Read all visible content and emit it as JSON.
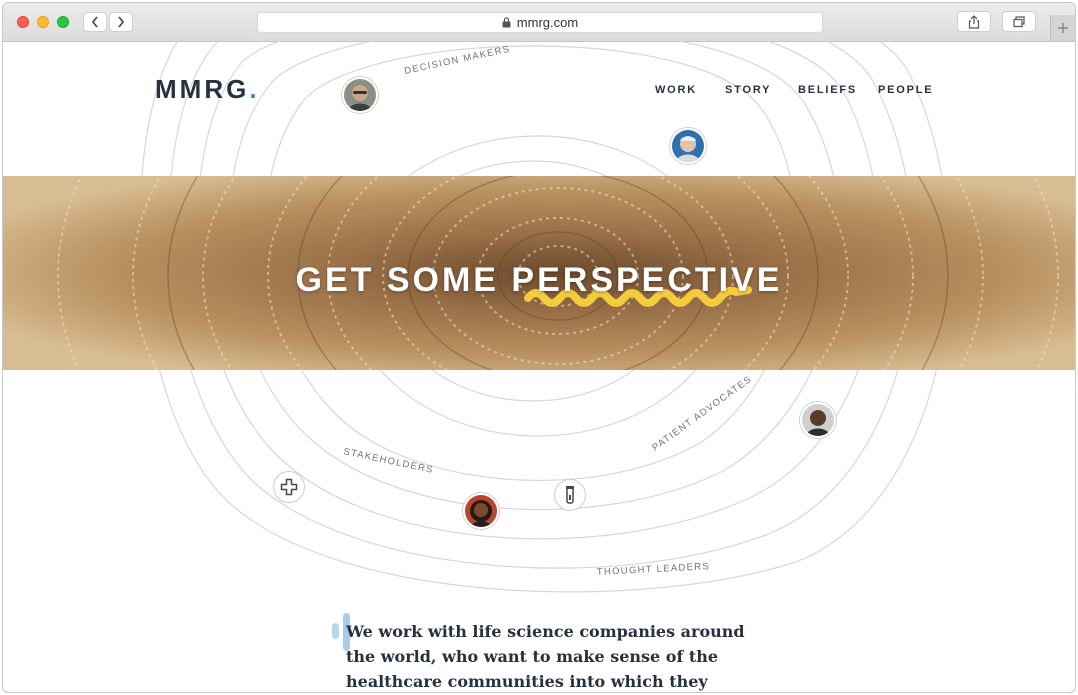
{
  "browser": {
    "url": "mmrg.com"
  },
  "site": {
    "logo": "MMRG",
    "logo_dot": ".",
    "nav": [
      "WORK",
      "STORY",
      "BELIEFS",
      "PEOPLE"
    ]
  },
  "hero": {
    "title": "GET SOME PERSPECTIVE"
  },
  "ring_labels": {
    "decision_makers": "DECISION MAKERS",
    "patient_advocates": "PATIENT ADVOCATES",
    "stakeholders": "STAKEHOLDERS",
    "thought_leaders": "THOUGHT LEADERS"
  },
  "intro": {
    "line1": "We work with life science companies around",
    "line2": "the world, who want to make sense of the",
    "line3": "healthcare communities into which they plan to"
  },
  "colors": {
    "accent_blue": "#3a86cf",
    "accent_yellow": "#f3cc3c",
    "text_dark": "#273140"
  },
  "icons": [
    "lock-icon",
    "share-icon",
    "tabs-icon",
    "medical-cross-icon",
    "vial-icon"
  ]
}
